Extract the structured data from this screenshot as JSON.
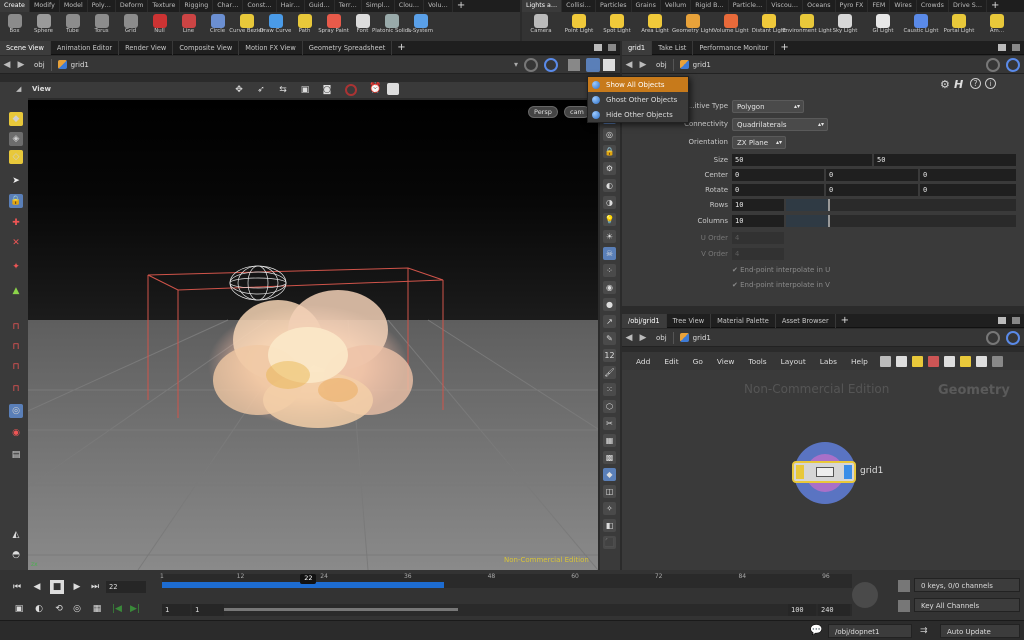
{
  "shelf_left": {
    "tabs": [
      "Create",
      "Modify",
      "Model",
      "Poly…",
      "Deform",
      "Texture",
      "Rigging",
      "Char…",
      "Const…",
      "Hair…",
      "Guid…",
      "Terr…",
      "Simpl…",
      "Clou…",
      "Volu…"
    ],
    "tools": [
      {
        "label": "Box",
        "icon": "box-icon",
        "color": "#8b8b8b"
      },
      {
        "label": "Sphere",
        "icon": "sphere-icon",
        "color": "#9a9a9a"
      },
      {
        "label": "Tube",
        "icon": "tube-icon",
        "color": "#8c8c8c"
      },
      {
        "label": "Torus",
        "icon": "torus-icon",
        "color": "#8c8c8c"
      },
      {
        "label": "Grid",
        "icon": "grid-icon",
        "color": "#8c8c8c"
      },
      {
        "label": "Null",
        "icon": "null-icon",
        "color": "#c33"
      },
      {
        "label": "Line",
        "icon": "line-icon",
        "color": "#c44"
      },
      {
        "label": "Circle",
        "icon": "circle-icon",
        "color": "#6b8fd1"
      },
      {
        "label": "Curve Bezier",
        "icon": "curve-bezier-icon",
        "color": "#e8c83a"
      },
      {
        "label": "Draw Curve",
        "icon": "draw-curve-icon",
        "color": "#4a9be8"
      },
      {
        "label": "Path",
        "icon": "path-icon",
        "color": "#e8c83a"
      },
      {
        "label": "Spray Paint",
        "icon": "spray-paint-icon",
        "color": "#e85a4a"
      },
      {
        "label": "Font",
        "icon": "font-icon",
        "color": "#ddd"
      },
      {
        "label": "Platonic Solids",
        "icon": "platonic-solids-icon",
        "color": "#9aa"
      },
      {
        "label": "L-System",
        "icon": "l-system-icon",
        "color": "#5aa0e8"
      }
    ]
  },
  "shelf_right": {
    "tabs": [
      "Lights a…",
      "Collisi…",
      "Particles",
      "Grains",
      "Vellum",
      "Rigid B…",
      "Particle…",
      "Viscou…",
      "Oceans",
      "Pyro FX",
      "FEM",
      "Wires",
      "Crowds",
      "Drive S…"
    ],
    "tools": [
      {
        "label": "Camera",
        "icon": "camera-icon",
        "color": "#bbb"
      },
      {
        "label": "Point Light",
        "icon": "point-light-icon",
        "color": "#f0c93a"
      },
      {
        "label": "Spot Light",
        "icon": "spot-light-icon",
        "color": "#f0c93a"
      },
      {
        "label": "Area Light",
        "icon": "area-light-icon",
        "color": "#f0c93a"
      },
      {
        "label": "Geometry Light",
        "icon": "geometry-light-icon",
        "color": "#e8a23a"
      },
      {
        "label": "Volume Light",
        "icon": "volume-light-icon",
        "color": "#e86a3a"
      },
      {
        "label": "Distant Light",
        "icon": "distant-light-icon",
        "color": "#f0c93a"
      },
      {
        "label": "Environment Light",
        "icon": "environment-light-icon",
        "color": "#e8c83a"
      },
      {
        "label": "Sky Light",
        "icon": "sky-light-icon",
        "color": "#d8d8d8"
      },
      {
        "label": "GI Light",
        "icon": "gi-light-icon",
        "color": "#e8e8e8"
      },
      {
        "label": "Caustic Light",
        "icon": "caustic-light-icon",
        "color": "#5a8ae8"
      },
      {
        "label": "Portal Light",
        "icon": "portal-light-icon",
        "color": "#e8c83a"
      },
      {
        "label": "Am…",
        "icon": "ambient-light-icon",
        "color": "#e8c83a"
      }
    ]
  },
  "left_pane": {
    "tabs": [
      "Scene View",
      "Animation Editor",
      "Render View",
      "Composite View",
      "Motion FX View",
      "Geometry Spreadsheet"
    ],
    "path": {
      "network": "obj",
      "node": "grid1"
    },
    "viewport_title": "View",
    "camera_buttons": [
      "Persp",
      "cam"
    ],
    "watermark": "Non-Commercial Edition"
  },
  "dropdown_menu": {
    "items": [
      "Show All Objects",
      "Ghost Other Objects",
      "Hide Other Objects"
    ],
    "active_index": 0
  },
  "right_top_pane": {
    "tabs": [
      "grid1",
      "Take List",
      "Performance Monitor"
    ],
    "path": {
      "network": "obj",
      "node": "grid1"
    },
    "params": {
      "primitive_type": {
        "label": "…itive Type",
        "value": "Polygon"
      },
      "connectivity": {
        "label": "Connectivity",
        "value": "Quadrilaterals"
      },
      "orientation": {
        "label": "Orientation",
        "value": "ZX Plane"
      },
      "size": {
        "label": "Size",
        "values": [
          "50",
          "50"
        ]
      },
      "center": {
        "label": "Center",
        "values": [
          "0",
          "0",
          "0"
        ]
      },
      "rotate": {
        "label": "Rotate",
        "values": [
          "0",
          "0",
          "0"
        ]
      },
      "rows": {
        "label": "Rows",
        "value": "10"
      },
      "columns": {
        "label": "Columns",
        "value": "10"
      },
      "u_order": {
        "label": "U Order",
        "value": "4"
      },
      "v_order": {
        "label": "V Order",
        "value": "4"
      },
      "interp_u": "End-point interpolate in U",
      "interp_v": "End-point interpolate in V"
    }
  },
  "right_bottom_pane": {
    "tabs": [
      "/obj/grid1",
      "Tree View",
      "Material Palette",
      "Asset Browser"
    ],
    "path": {
      "network": "obj",
      "node": "grid1"
    },
    "menu": [
      "Add",
      "Edit",
      "Go",
      "View",
      "Tools",
      "Layout",
      "Labs",
      "Help"
    ],
    "watermark": "Non-Commercial Edition",
    "context_label": "Geometry",
    "node_name": "grid1"
  },
  "timeline": {
    "current_frame": "22",
    "ticks": [
      "1",
      "12",
      "24",
      "36",
      "48",
      "60",
      "72",
      "84",
      "96"
    ],
    "playhead_label": "22",
    "range_start": "1",
    "range_start2": "1",
    "range_end": "100",
    "range_end2": "240",
    "keys_info": "0 keys, 0/0 channels",
    "key_mode": "Key All Channels"
  },
  "status_bar": {
    "path": "/obj/dopnet1",
    "update_mode": "Auto Update"
  }
}
